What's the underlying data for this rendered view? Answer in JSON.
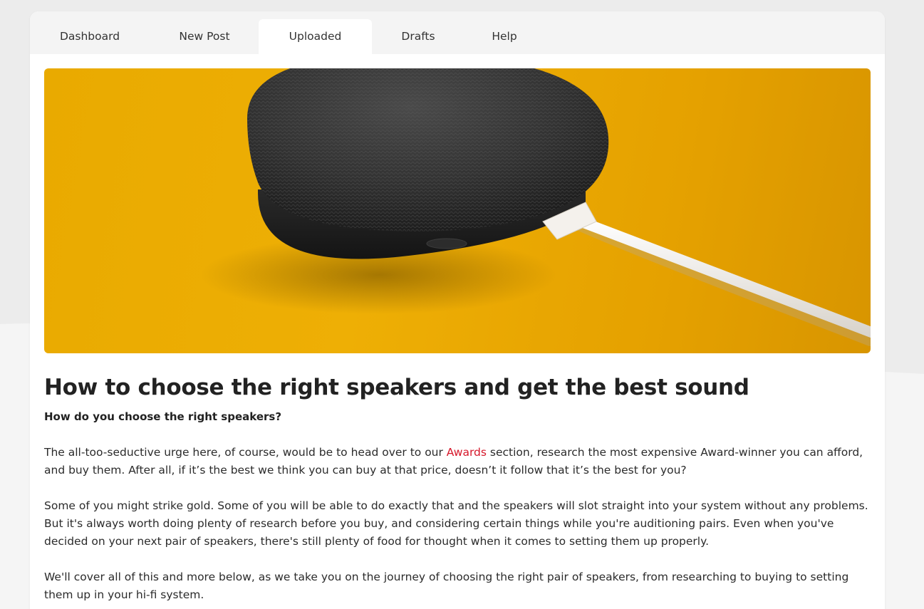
{
  "tabs": [
    {
      "label": "Dashboard",
      "active": false
    },
    {
      "label": "New Post",
      "active": false
    },
    {
      "label": "Uploaded",
      "active": true
    },
    {
      "label": "Drafts",
      "active": false
    },
    {
      "label": "Help",
      "active": false
    }
  ],
  "article": {
    "hero_image": "speaker-photo",
    "title": "How to choose the right speakers and get the best sound",
    "subtitle": "How do you choose the right speakers?",
    "paragraph1": {
      "before_link": "The all-too-seductive urge here, of course, would be to head over to our ",
      "link_text": "Awards",
      "after_link": " section, research the most expensive Award-winner you can afford, and buy them. After all, if it’s the best we think you can buy at that price, doesn’t it follow that it’s the best for you?"
    },
    "paragraph2": "Some of you might strike gold. Some of you will be able to do exactly that and the speakers will slot straight into your system without any problems. But it's always worth doing plenty of research before you buy, and considering certain things while you're auditioning pairs. Even when you've decided on your next pair of speakers, there's still plenty of food for thought when it comes to setting them up properly.",
    "paragraph3": "We'll cover all of this and more below, as we take you on the journey of choosing the right pair of speakers, from researching to buying to setting them up in your hi-fi system."
  },
  "colors": {
    "link": "#d6182b",
    "hero_background": "#eaa900",
    "page_background": "#ececec"
  }
}
